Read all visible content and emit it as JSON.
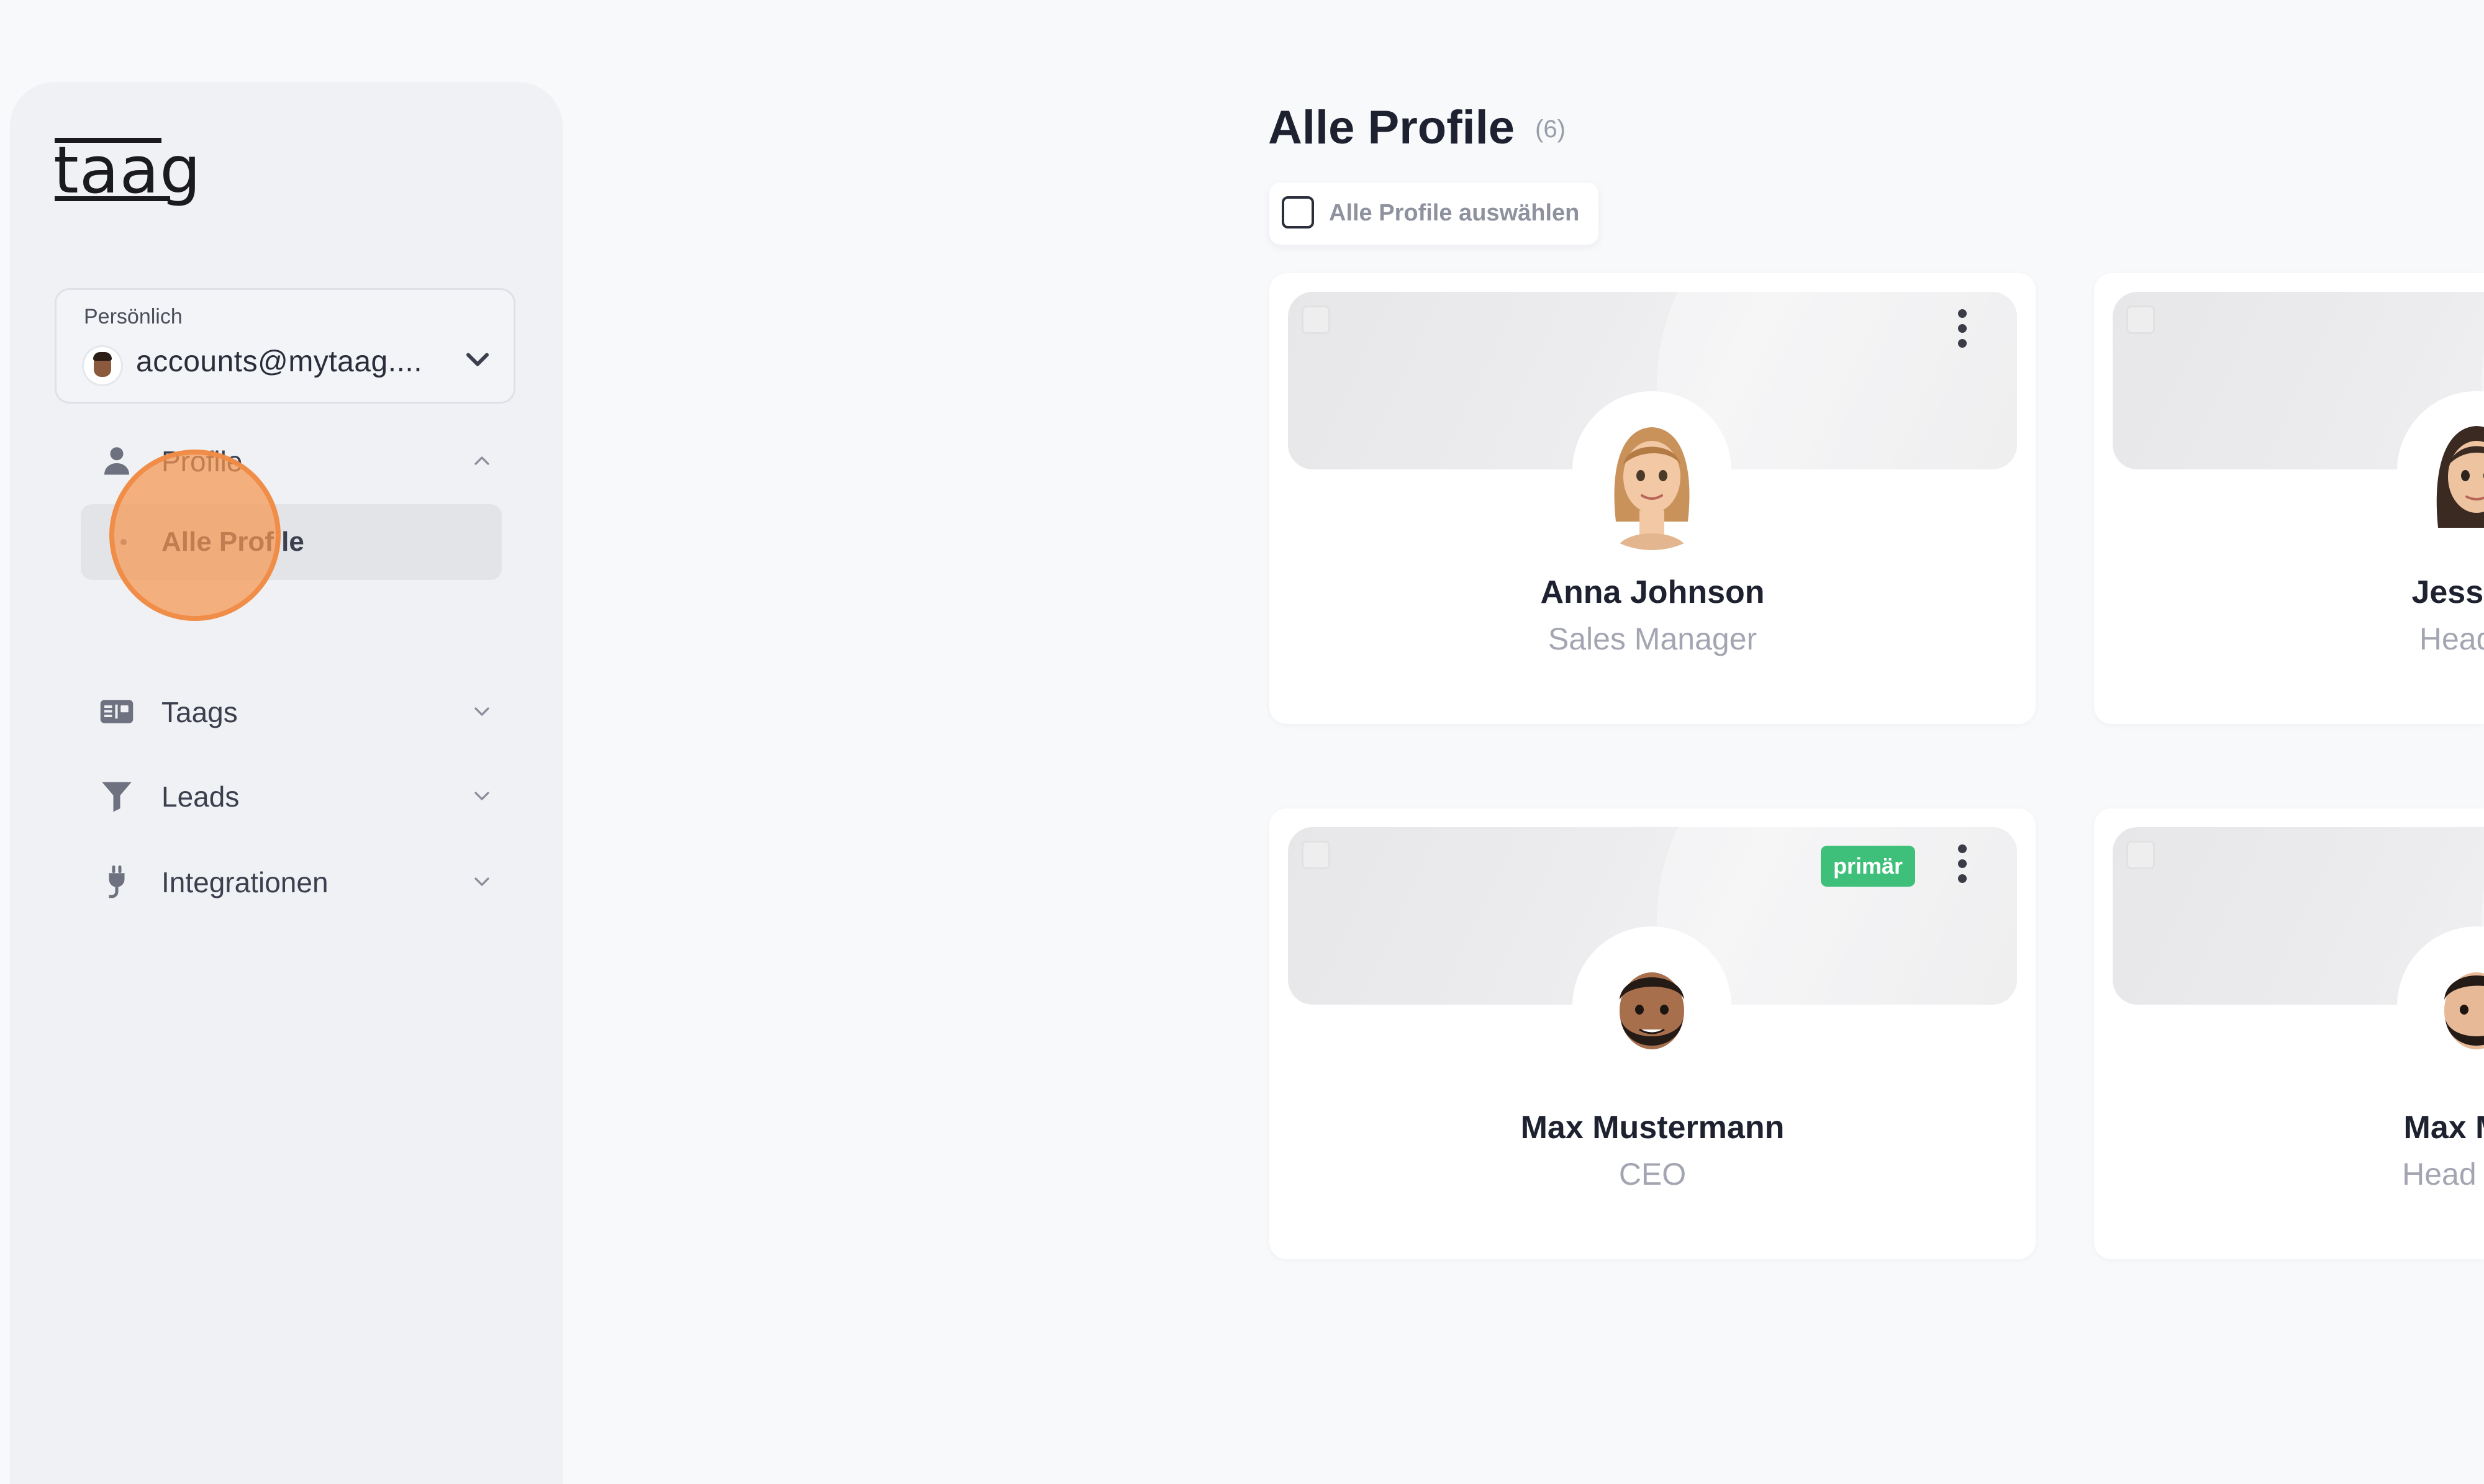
{
  "app": {
    "logo": "taag"
  },
  "account": {
    "label": "Persönlich",
    "email": "accounts@mytaag...."
  },
  "nav": {
    "profile": "Profile",
    "alle_profile": "Alle Profile",
    "taags": "Taags",
    "leads": "Leads",
    "integrationen": "Integrationen"
  },
  "main": {
    "title": "Alle Profile",
    "count": "(6)",
    "select_all": "Alle Profile auswählen"
  },
  "cards": [
    {
      "name": "Anna Johnson",
      "role": "Sales Manager",
      "badge": ""
    },
    {
      "name": "Jessie D",
      "role": "Head Of",
      "badge": ""
    },
    {
      "name": "Max Mustermann",
      "role": "CEO",
      "badge": "primär"
    },
    {
      "name": "Max Must",
      "role": "Head Of M",
      "badge": ""
    }
  ],
  "colors": {
    "accent_green": "#3fc07a",
    "click_marker": "#f59650"
  }
}
